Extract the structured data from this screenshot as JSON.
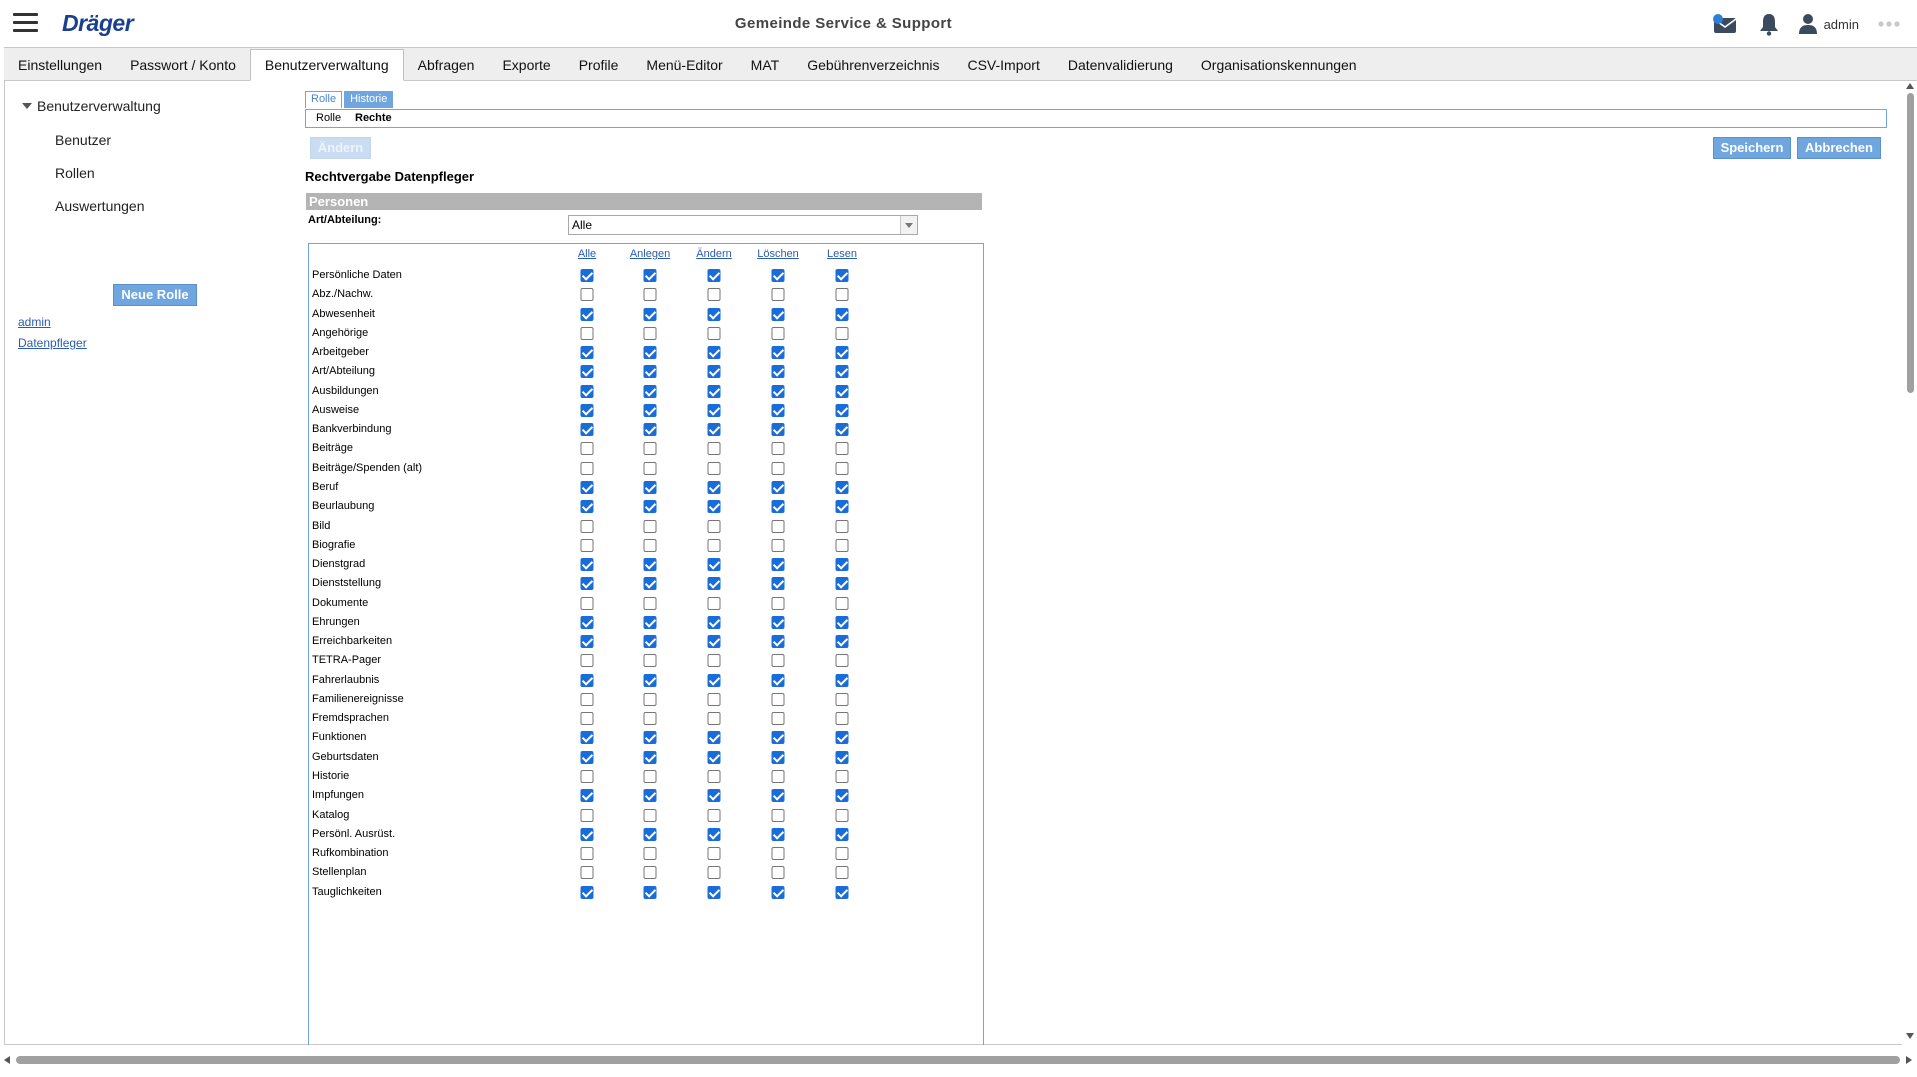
{
  "header": {
    "logo_text": "Dräger",
    "title": "Gemeinde Service & Support",
    "user_name": "admin",
    "icons": [
      "menu-icon",
      "mail-icon",
      "bell-icon",
      "user-icon",
      "more-icon"
    ]
  },
  "tabs": [
    {
      "label": "Einstellungen",
      "active": false
    },
    {
      "label": "Passwort / Konto",
      "active": false
    },
    {
      "label": "Benutzerverwaltung",
      "active": true
    },
    {
      "label": "Abfragen",
      "active": false
    },
    {
      "label": "Exporte",
      "active": false
    },
    {
      "label": "Profile",
      "active": false
    },
    {
      "label": "Menü-Editor",
      "active": false
    },
    {
      "label": "MAT",
      "active": false
    },
    {
      "label": "Gebührenverzeichnis",
      "active": false
    },
    {
      "label": "CSV-Import",
      "active": false
    },
    {
      "label": "Datenvalidierung",
      "active": false
    },
    {
      "label": "Organisationskennungen",
      "active": false
    }
  ],
  "sidebar": {
    "root": "Benutzerverwaltung",
    "items": [
      "Benutzer",
      "Rollen",
      "Auswertungen"
    ],
    "new_role_button": "Neue Rolle",
    "roles": [
      "admin",
      "Datenpfleger"
    ]
  },
  "main": {
    "subtab_rolle": "Rolle",
    "subtab_historie": "Historie",
    "path_rolle": "Rolle",
    "path_rechte": "Rechte",
    "aendern_button": "Ändern",
    "save_button": "Speichern",
    "cancel_button": "Abbrechen",
    "section_title": "Rechtvergabe Datenpfleger",
    "group_title": "Personen",
    "filter_label": "Art/Abteilung:",
    "filter_value": "Alle",
    "columns": [
      "Alle",
      "Anlegen",
      "Ändern",
      "Löschen",
      "Lesen"
    ],
    "rows": [
      {
        "label": "Persönliche Daten",
        "checked": true
      },
      {
        "label": "Abz./Nachw.",
        "checked": false
      },
      {
        "label": "Abwesenheit",
        "checked": true
      },
      {
        "label": "Angehörige",
        "checked": false
      },
      {
        "label": "Arbeitgeber",
        "checked": true
      },
      {
        "label": "Art/Abteilung",
        "checked": true
      },
      {
        "label": "Ausbildungen",
        "checked": true
      },
      {
        "label": "Ausweise",
        "checked": true
      },
      {
        "label": "Bankverbindung",
        "checked": true
      },
      {
        "label": "Beiträge",
        "checked": false
      },
      {
        "label": "Beiträge/Spenden (alt)",
        "checked": false
      },
      {
        "label": "Beruf",
        "checked": true
      },
      {
        "label": "Beurlaubung",
        "checked": true
      },
      {
        "label": "Bild",
        "checked": false
      },
      {
        "label": "Biografie",
        "checked": false
      },
      {
        "label": "Dienstgrad",
        "checked": true
      },
      {
        "label": "Dienststellung",
        "checked": true
      },
      {
        "label": "Dokumente",
        "checked": false
      },
      {
        "label": "Ehrungen",
        "checked": true
      },
      {
        "label": "Erreichbarkeiten",
        "checked": true
      },
      {
        "label": "TETRA-Pager",
        "checked": false
      },
      {
        "label": "Fahrerlaubnis",
        "checked": true
      },
      {
        "label": "Familienereignisse",
        "checked": false
      },
      {
        "label": "Fremdsprachen",
        "checked": false
      },
      {
        "label": "Funktionen",
        "checked": true
      },
      {
        "label": "Geburtsdaten",
        "checked": true
      },
      {
        "label": "Historie",
        "checked": false
      },
      {
        "label": "Impfungen",
        "checked": true
      },
      {
        "label": "Katalog",
        "checked": false
      },
      {
        "label": "Persönl. Ausrüst.",
        "checked": true
      },
      {
        "label": "Rufkombination",
        "checked": false
      },
      {
        "label": "Stellenplan",
        "checked": false
      },
      {
        "label": "Tauglichkeiten",
        "checked": true
      }
    ]
  }
}
